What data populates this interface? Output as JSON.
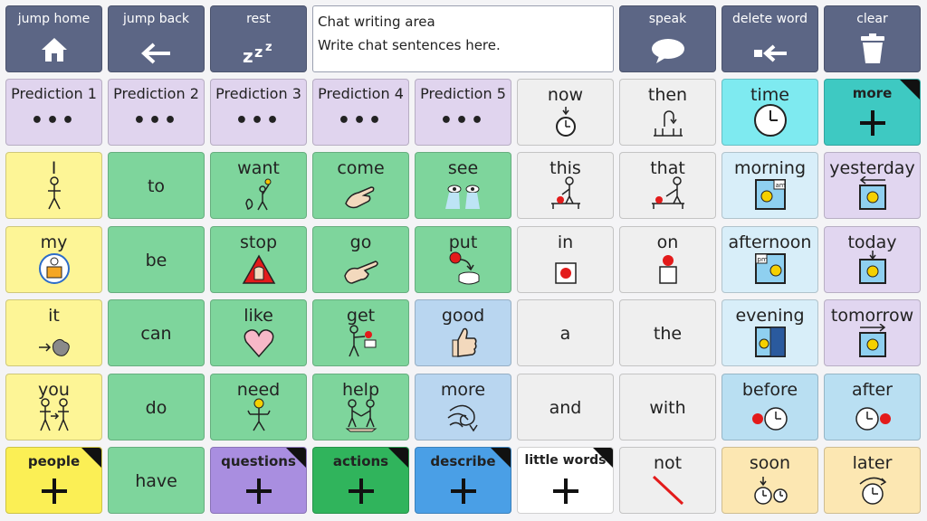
{
  "top_bar": {
    "jump_home": "jump home",
    "jump_back": "jump back",
    "rest": "rest",
    "speak": "speak",
    "delete_word": "delete word",
    "clear": "clear"
  },
  "chat": {
    "title": "Chat writing area",
    "placeholder": "Write chat sentences here."
  },
  "predictions": [
    "Prediction 1",
    "Prediction 2",
    "Prediction 3",
    "Prediction 4",
    "Prediction 5"
  ],
  "row1": {
    "now": "now",
    "then": "then",
    "time": "time",
    "more": "more"
  },
  "row2": [
    "I",
    "to",
    "want",
    "come",
    "see",
    "this",
    "that",
    "morning",
    "yesterday"
  ],
  "row3": [
    "my",
    "be",
    "stop",
    "go",
    "put",
    "in",
    "on",
    "afternoon",
    "today"
  ],
  "row4": [
    "it",
    "can",
    "like",
    "get",
    "good",
    "a",
    "the",
    "evening",
    "tomorrow"
  ],
  "row5": [
    "you",
    "do",
    "need",
    "help",
    "more",
    "and",
    "with",
    "before",
    "after"
  ],
  "row6": [
    "people",
    "have",
    "questions",
    "actions",
    "describe",
    "little words",
    "not",
    "soon",
    "later"
  ],
  "colors": {
    "pronoun": "#fdf596",
    "verb": "#7ed59c",
    "adjective": "#b9d6f0",
    "little": "#efefef",
    "time": "#d8eef9",
    "time_today": "#e1d6f0",
    "prediction": "#e0d4ee",
    "topbar": "#5c6685"
  }
}
